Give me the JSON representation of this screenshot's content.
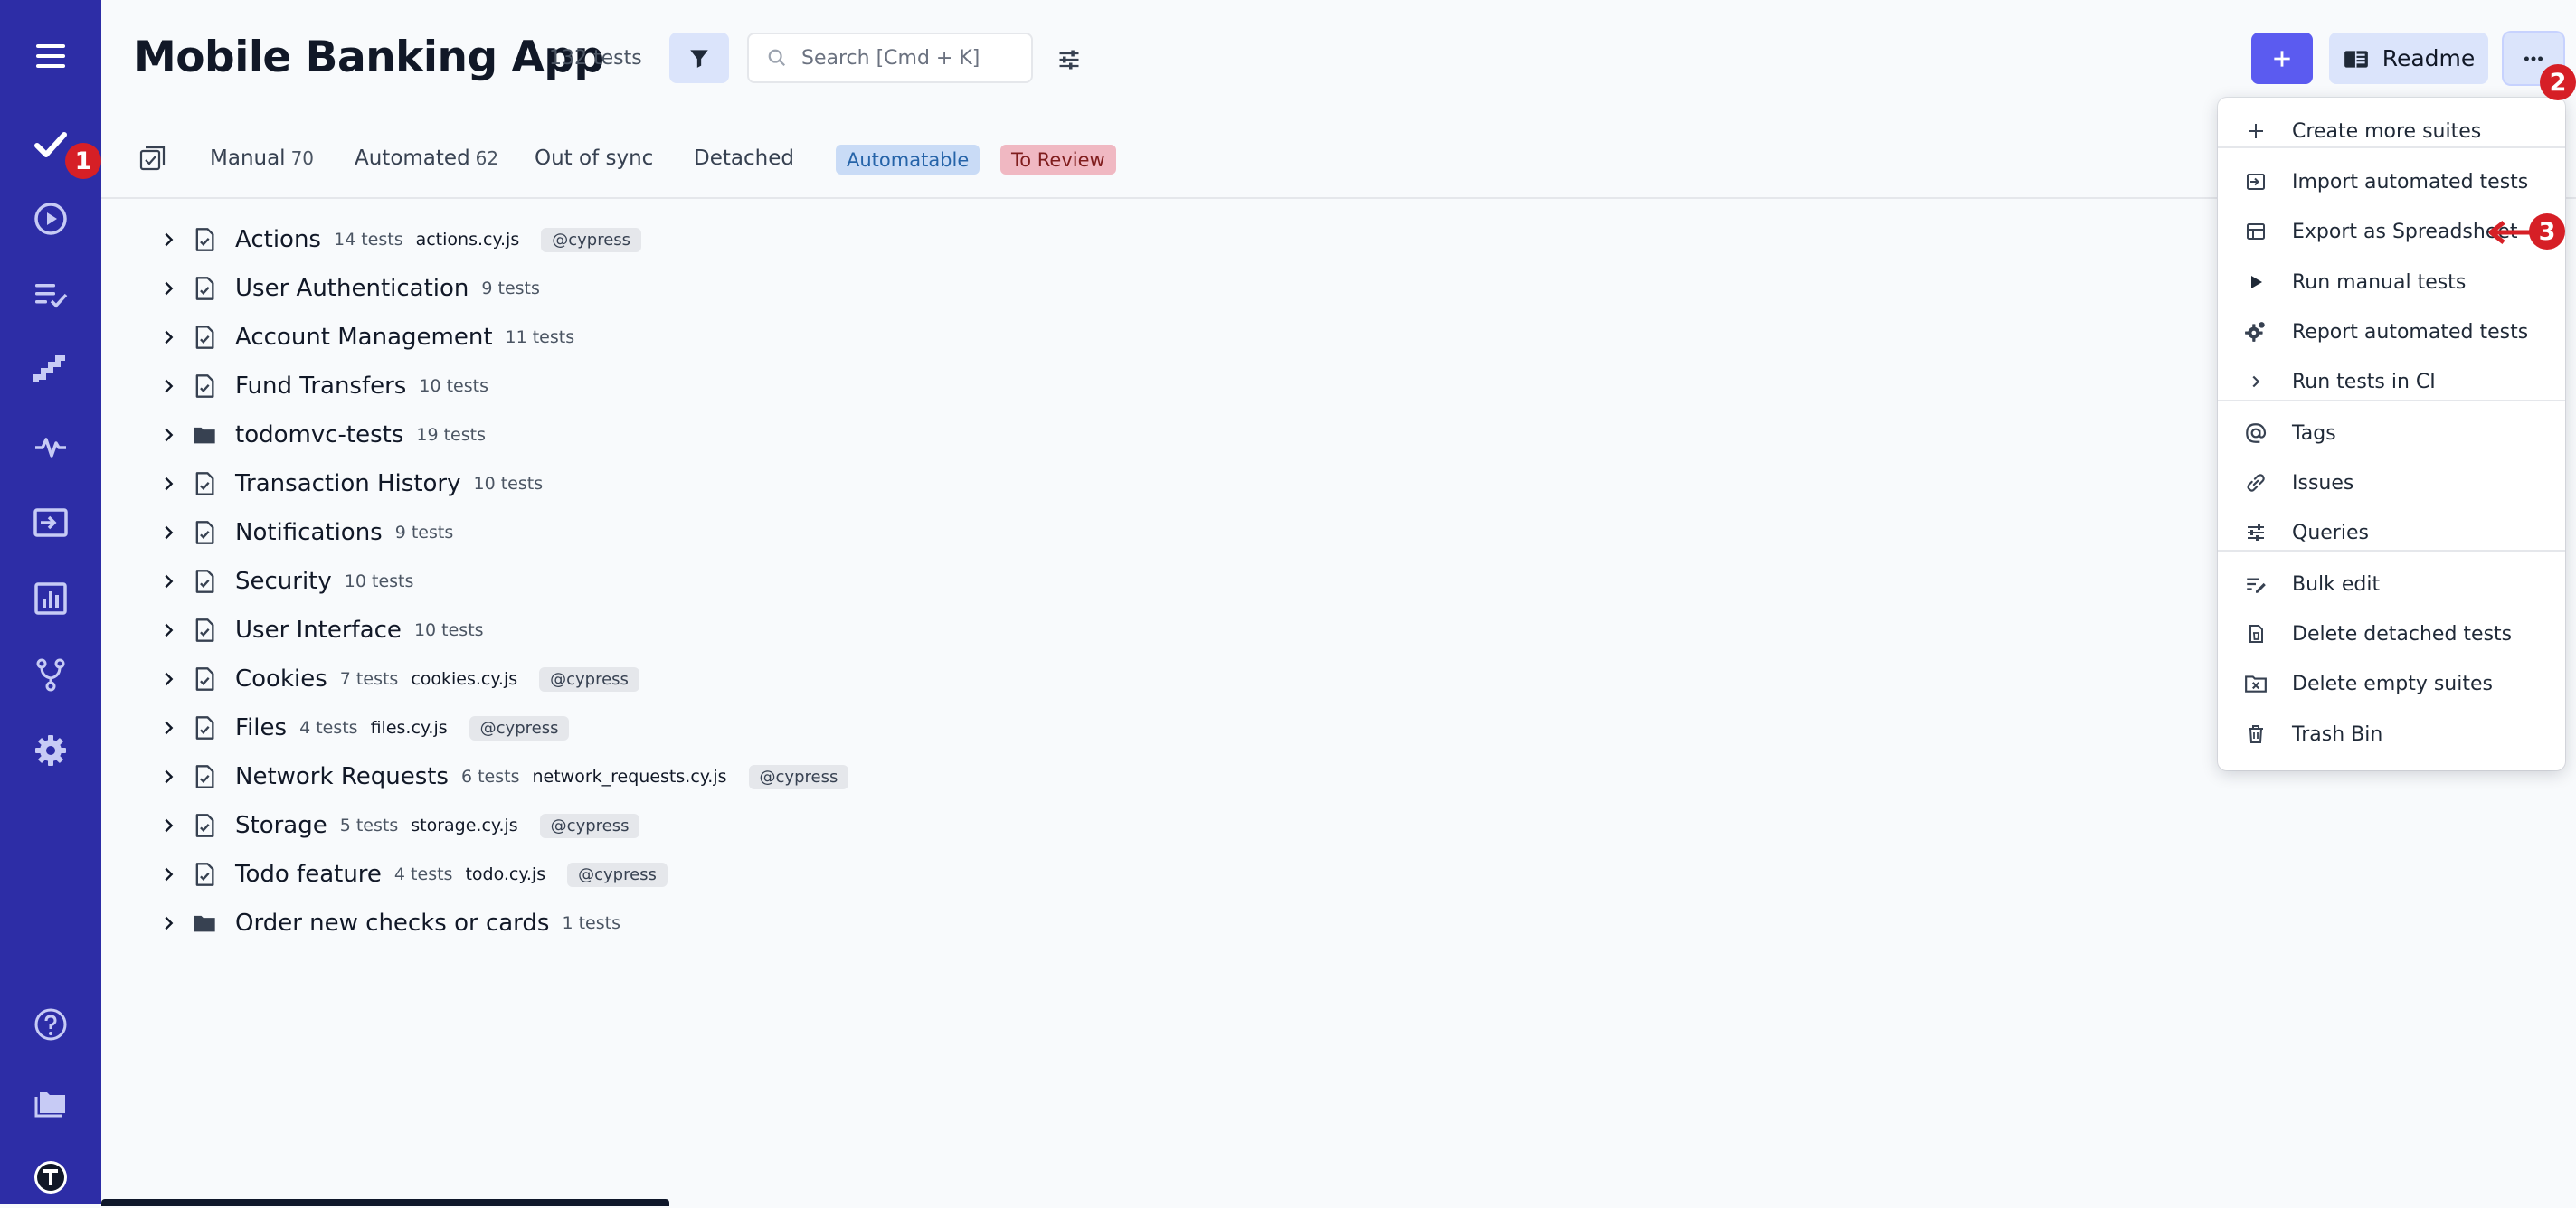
{
  "sidebar": {
    "items": [
      {
        "name": "menu-icon"
      },
      {
        "name": "tests-check-icon"
      },
      {
        "name": "runs-play-icon"
      },
      {
        "name": "plans-list-check-icon"
      },
      {
        "name": "steps-icon"
      },
      {
        "name": "pulse-icon"
      },
      {
        "name": "import-icon"
      },
      {
        "name": "analytics-chart-icon"
      },
      {
        "name": "branch-icon"
      },
      {
        "name": "settings-gear-icon"
      },
      {
        "name": "help-icon"
      },
      {
        "name": "projects-folder-icon"
      },
      {
        "name": "user-avatar-icon"
      }
    ],
    "color": "#2d2da6"
  },
  "markers": {
    "m1": "1",
    "m2": "2",
    "m3": "3"
  },
  "header": {
    "title": "Mobile Banking App",
    "count": "132 tests",
    "search_placeholder": "Search [Cmd + K]",
    "readme_label": "Readme"
  },
  "tabs": {
    "manual_label": "Manual",
    "manual_count": "70",
    "automated_label": "Automated",
    "automated_count": "62",
    "out_of_sync": "Out of sync",
    "detached": "Detached",
    "automatable": "Automatable",
    "to_review": "To Review"
  },
  "suites": [
    {
      "name": "Actions",
      "count": "14 tests",
      "file": "actions.cy.js",
      "tag": "@cypress",
      "type": "file"
    },
    {
      "name": "User Authentication",
      "count": "9 tests",
      "file": "",
      "tag": "",
      "type": "file"
    },
    {
      "name": "Account Management",
      "count": "11 tests",
      "file": "",
      "tag": "",
      "type": "file"
    },
    {
      "name": "Fund Transfers",
      "count": "10 tests",
      "file": "",
      "tag": "",
      "type": "file"
    },
    {
      "name": "todomvc-tests",
      "count": "19 tests",
      "file": "",
      "tag": "",
      "type": "folder"
    },
    {
      "name": "Transaction History",
      "count": "10 tests",
      "file": "",
      "tag": "",
      "type": "file"
    },
    {
      "name": "Notifications",
      "count": "9 tests",
      "file": "",
      "tag": "",
      "type": "file"
    },
    {
      "name": "Security",
      "count": "10 tests",
      "file": "",
      "tag": "",
      "type": "file"
    },
    {
      "name": "User Interface",
      "count": "10 tests",
      "file": "",
      "tag": "",
      "type": "file"
    },
    {
      "name": "Cookies",
      "count": "7 tests",
      "file": "cookies.cy.js",
      "tag": "@cypress",
      "type": "file"
    },
    {
      "name": "Files",
      "count": "4 tests",
      "file": "files.cy.js",
      "tag": "@cypress",
      "type": "file"
    },
    {
      "name": "Network Requests",
      "count": "6 tests",
      "file": "network_requests.cy.js",
      "tag": "@cypress",
      "type": "file"
    },
    {
      "name": "Storage",
      "count": "5 tests",
      "file": "storage.cy.js",
      "tag": "@cypress",
      "type": "file"
    },
    {
      "name": "Todo feature",
      "count": "4 tests",
      "file": "todo.cy.js",
      "tag": "@cypress",
      "type": "file"
    },
    {
      "name": "Order new checks or cards",
      "count": "1 tests",
      "file": "",
      "tag": "",
      "type": "folder"
    }
  ],
  "menu": {
    "items": [
      {
        "label": "Create more suites",
        "icon": "plus-icon"
      },
      {
        "label": "Import automated tests",
        "icon": "import-icon"
      },
      {
        "label": "Export as Spreadsheet",
        "icon": "table-icon"
      },
      {
        "label": "Run manual tests",
        "icon": "play-icon"
      },
      {
        "label": "Report automated tests",
        "icon": "cog-icon"
      },
      {
        "label": "Run tests in CI",
        "icon": "chevron-right-icon"
      },
      {
        "label": "Tags",
        "icon": "at-icon"
      },
      {
        "label": "Issues",
        "icon": "link-icon"
      },
      {
        "label": "Queries",
        "icon": "sliders-icon"
      },
      {
        "label": "Bulk edit",
        "icon": "edit-list-icon"
      },
      {
        "label": "Delete detached tests",
        "icon": "delete-file-icon"
      },
      {
        "label": "Delete empty suites",
        "icon": "delete-folder-icon"
      },
      {
        "label": "Trash Bin",
        "icon": "trash-icon"
      }
    ]
  },
  "colors": {
    "accent": "#5b5bf0",
    "light_accent": "#dbe4fb",
    "automatable_bg": "#c9dbf6",
    "to_review_bg": "#f0b8c2",
    "marker": "#d61f26"
  }
}
